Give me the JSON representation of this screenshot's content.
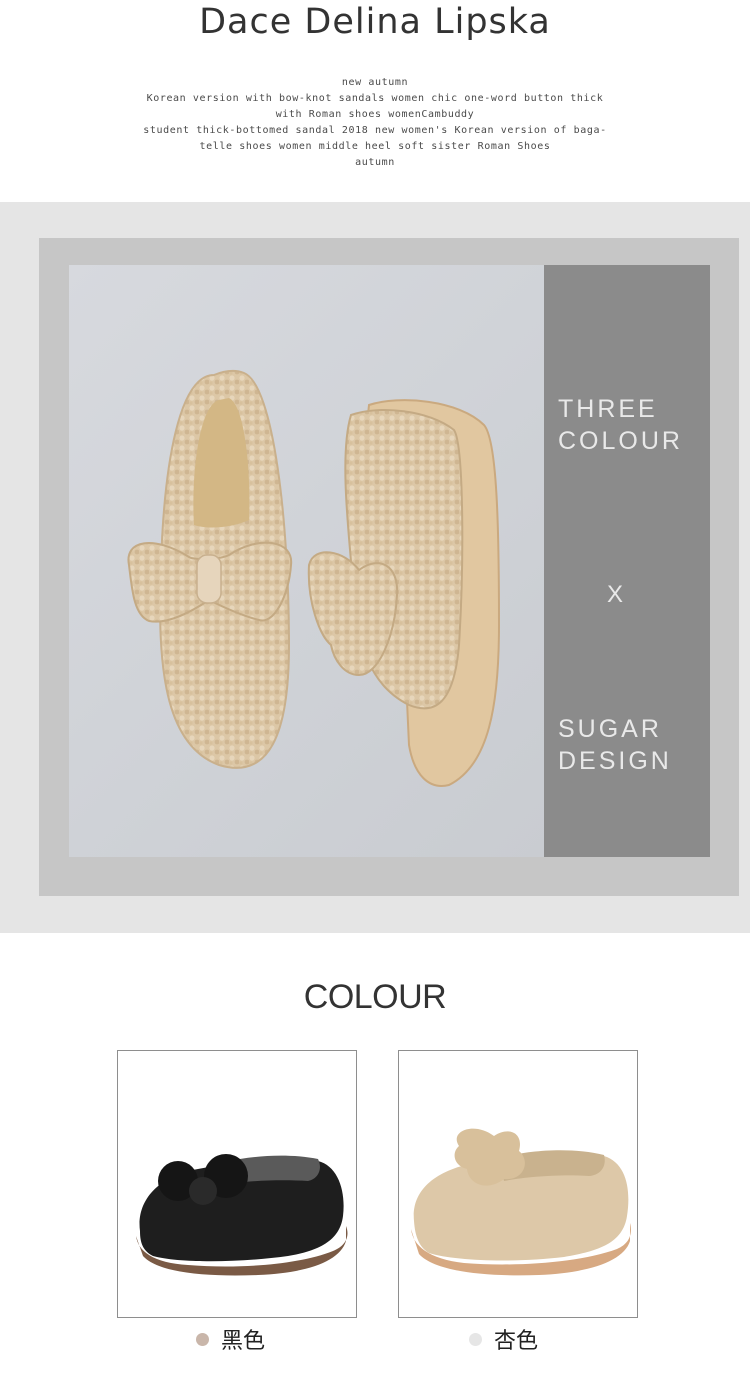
{
  "header": {
    "brand": "Dace Delina Lipska",
    "description_lines": [
      "new autumn",
      "Korean version with bow-knot sandals women chic one-word button thick",
      "with Roman shoes womenCambuddy",
      "student thick-bottomed sandal 2018 new women's Korean version of baga-",
      "telle shoes women middle heel soft sister Roman Shoes",
      "autumn"
    ]
  },
  "banner": {
    "side_top_line1": "THREE",
    "side_top_line2": "COLOUR",
    "side_mid": "X",
    "side_bottom_line1": "SUGAR",
    "side_bottom_line2": "DESIGN",
    "photo_icon": "fuzzy-bow-slipper-pair-illustration"
  },
  "colour_section": {
    "title": "COLOUR",
    "options": [
      {
        "label": "黑色",
        "dot_color": "#c9b6aa",
        "shoe_color": "#1e1e1e",
        "sole_color": "#7a5a45"
      },
      {
        "label": "杏色",
        "dot_color": "#e6e6e6",
        "shoe_color": "#d9c4a6",
        "sole_color": "#d7a982"
      }
    ]
  }
}
